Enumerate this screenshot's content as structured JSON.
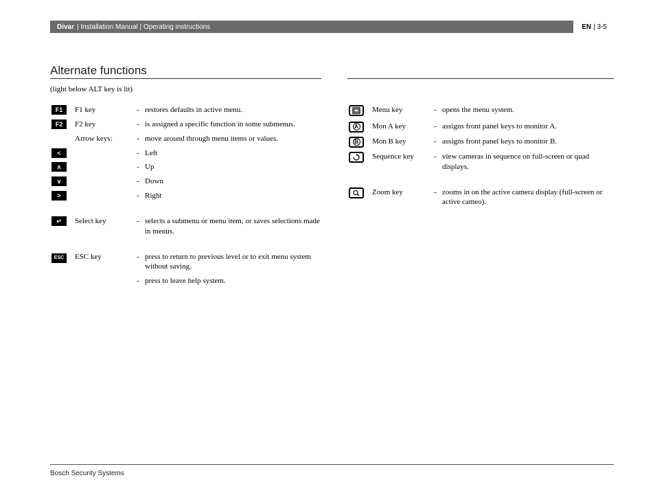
{
  "header": {
    "product": "Divar",
    "breadcrumb": "| Installation Manual | Operating instructions",
    "lang": "EN",
    "page": "| 3-5"
  },
  "section": {
    "title": "Alternate functions",
    "subtitle": "(light below ALT key is lit)"
  },
  "left": [
    {
      "icon": "F1",
      "icon_type": "badge",
      "name": "F1 key",
      "desc": "restores defaults in active menu."
    },
    {
      "icon": "F2",
      "icon_type": "badge",
      "name": "F2 key",
      "desc": "is assigned a specific function in some submenus."
    },
    {
      "icon": "",
      "icon_type": "none",
      "name": "Arrow keys:",
      "desc": "move around through menu items or values."
    },
    {
      "icon": "<",
      "icon_type": "badge",
      "name": "",
      "desc": "Left"
    },
    {
      "icon": "∧",
      "icon_type": "badge",
      "name": "",
      "desc": "Up"
    },
    {
      "icon": "∨",
      "icon_type": "badge",
      "name": "",
      "desc": "Down"
    },
    {
      "icon": ">",
      "icon_type": "badge",
      "name": "",
      "desc": "Right"
    },
    {
      "gap": true
    },
    {
      "icon": "↵",
      "icon_type": "badge",
      "name": "Select key",
      "desc": "selects a submenu or menu item, or saves selections made in menus."
    },
    {
      "gap": true
    },
    {
      "icon": "ESC",
      "icon_type": "badge-sm",
      "name": "ESC key",
      "desc": "press to return to previous level or to exit menu system without saving."
    },
    {
      "icon": "",
      "icon_type": "none",
      "name": "",
      "desc": "press to leave help system."
    }
  ],
  "right": [
    {
      "icon": "menu",
      "icon_type": "svg",
      "name": "Menu key",
      "desc": "opens the menu system."
    },
    {
      "icon": "A",
      "icon_type": "mon",
      "name": "Mon A key",
      "desc": "assigns front panel keys to monitor A."
    },
    {
      "icon": "B",
      "icon_type": "mon",
      "name": "Mon B key",
      "desc": "assigns front panel keys to monitor B."
    },
    {
      "icon": "seq",
      "icon_type": "svg",
      "name": "Sequence key",
      "desc": "view cameras in sequence on full-screen or quad displays."
    },
    {
      "gap": true
    },
    {
      "icon": "zoom",
      "icon_type": "svg",
      "name": "Zoom key",
      "desc": "zooms in on the active camera display (full-screen or active cameo)."
    }
  ],
  "footer": "Bosch Security Systems"
}
